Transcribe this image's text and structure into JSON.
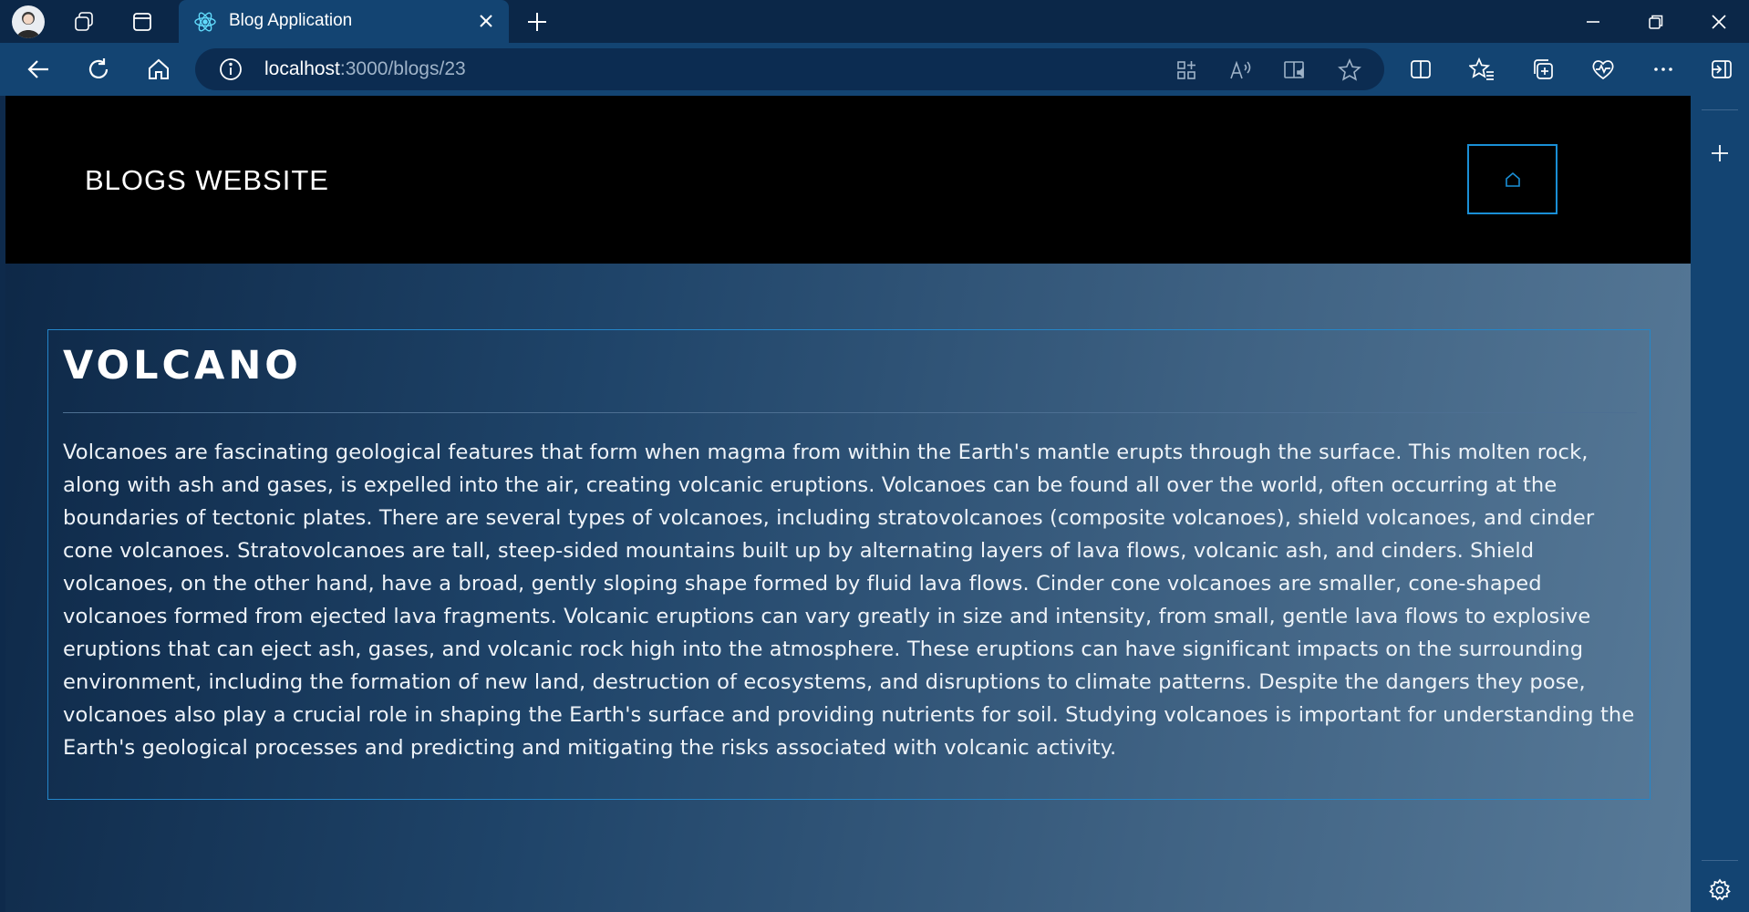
{
  "browser": {
    "tab_title": "Blog Application",
    "url_host": "localhost",
    "url_path": ":3000/blogs/23"
  },
  "site": {
    "brand": "BLOGS WEBSITE"
  },
  "post": {
    "title": "VOLCANO",
    "body": "Volcanoes are fascinating geological features that form when magma from within the Earth's mantle erupts through the surface. This molten rock, along with ash and gases, is expelled into the air, creating volcanic eruptions. Volcanoes can be found all over the world, often occurring at the boundaries of tectonic plates. There are several types of volcanoes, including stratovolcanoes (composite volcanoes), shield volcanoes, and cinder cone volcanoes. Stratovolcanoes are tall, steep-sided mountains built up by alternating layers of lava flows, volcanic ash, and cinders. Shield volcanoes, on the other hand, have a broad, gently sloping shape formed by fluid lava flows. Cinder cone volcanoes are smaller, cone-shaped volcanoes formed from ejected lava fragments. Volcanic eruptions can vary greatly in size and intensity, from small, gentle lava flows to explosive eruptions that can eject ash, gases, and volcanic rock high into the atmosphere. These eruptions can have significant impacts on the surrounding environment, including the formation of new land, destruction of ecosystems, and disruptions to climate patterns. Despite the dangers they pose, volcanoes also play a crucial role in shaping the Earth's surface and providing nutrients for soil. Studying volcanoes is important for understanding the Earth's geological processes and predicting and mitigating the risks associated with volcanic activity."
  },
  "colors": {
    "accent": "#1a8fd6",
    "header_bg": "#000000",
    "browser_frame": "#134472"
  },
  "icons": [
    "profile-avatar-icon",
    "workspaces-icon",
    "tab-actions-icon",
    "react-favicon-icon",
    "close-tab-icon",
    "new-tab-icon",
    "minimize-icon",
    "restore-icon",
    "close-window-icon",
    "back-icon",
    "refresh-icon",
    "home-icon",
    "site-info-icon",
    "apps-icon",
    "read-aloud-icon",
    "immersive-reader-icon",
    "favorite-star-icon",
    "split-screen-icon",
    "favorites-icon",
    "collections-icon",
    "browser-essentials-icon",
    "more-icon",
    "sidebar-toggle-icon",
    "add-sidebar-icon",
    "settings-icon",
    "site-home-icon"
  ]
}
